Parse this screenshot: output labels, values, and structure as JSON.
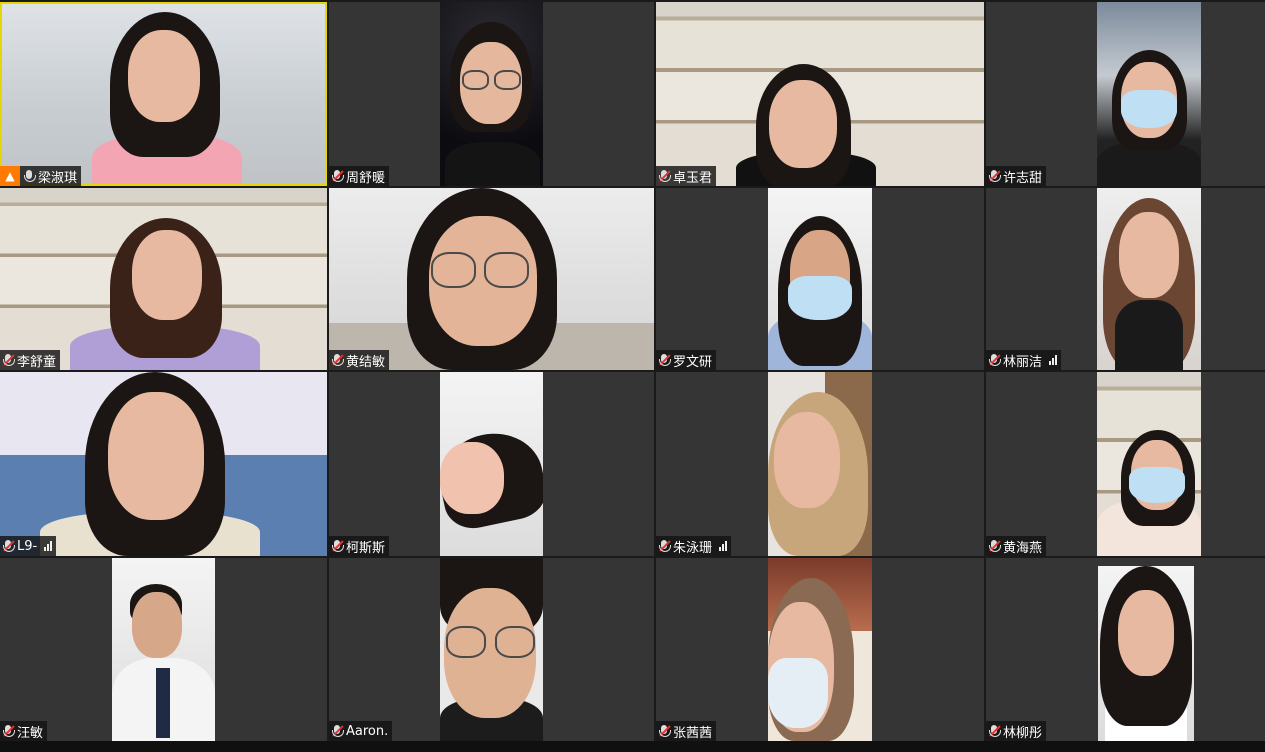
{
  "participants": [
    {
      "name": "梁淑琪",
      "host": true,
      "muted": false,
      "signal": false
    },
    {
      "name": "周舒暖",
      "host": false,
      "muted": true,
      "signal": false
    },
    {
      "name": "卓玉君",
      "host": false,
      "muted": true,
      "signal": false
    },
    {
      "name": "许志甜",
      "host": false,
      "muted": true,
      "signal": false
    },
    {
      "name": "李舒童",
      "host": false,
      "muted": true,
      "signal": false
    },
    {
      "name": "黄结敏",
      "host": false,
      "muted": true,
      "signal": false
    },
    {
      "name": "罗文研",
      "host": false,
      "muted": true,
      "signal": false
    },
    {
      "name": "林丽洁",
      "host": false,
      "muted": true,
      "signal": true
    },
    {
      "name": "L9-",
      "host": false,
      "muted": true,
      "signal": true
    },
    {
      "name": "柯斯斯",
      "host": false,
      "muted": true,
      "signal": false
    },
    {
      "name": "朱泳珊",
      "host": false,
      "muted": true,
      "signal": true
    },
    {
      "name": "黄海燕",
      "host": false,
      "muted": true,
      "signal": false
    },
    {
      "name": "汪敏",
      "host": false,
      "muted": true,
      "signal": false
    },
    {
      "name": "Aaron.",
      "host": false,
      "muted": true,
      "signal": false
    },
    {
      "name": "张茜茜",
      "host": false,
      "muted": true,
      "signal": false
    },
    {
      "name": "林柳彤",
      "host": false,
      "muted": true,
      "signal": false
    }
  ],
  "icons": {
    "host": "person-icon",
    "mic": "microphone-icon",
    "muted_mic": "muted-microphone-icon",
    "signal": "signal-strength-icon"
  },
  "colors": {
    "host_badge": "#ff7a00",
    "muted_slash": "#e8312f",
    "active_speaker_border": "#e7d600",
    "tile_bg": "#353535"
  }
}
